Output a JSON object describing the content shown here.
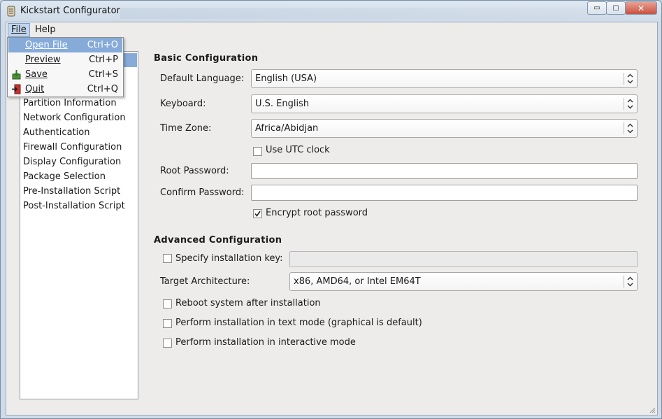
{
  "window": {
    "title": "Kickstart Configurator",
    "minimize_glyph": "▭",
    "maximize_glyph": "▢",
    "close_glyph": "✕"
  },
  "menubar": {
    "file": "File",
    "help": "Help"
  },
  "file_menu": {
    "items": [
      {
        "label": "Open File",
        "accel": "Ctrl+O",
        "icon": ""
      },
      {
        "label": "Preview",
        "accel": "Ctrl+P",
        "icon": ""
      },
      {
        "label": "Save",
        "accel": "Ctrl+S",
        "icon": "save-icon"
      },
      {
        "label": "Quit",
        "accel": "Ctrl+Q",
        "icon": "quit-icon"
      }
    ]
  },
  "sidebar": {
    "items": [
      "Partition Information",
      "Network Configuration",
      "Authentication",
      "Firewall Configuration",
      "Display Configuration",
      "Package Selection",
      "Pre-Installation Script",
      "Post-Installation Script"
    ]
  },
  "basic": {
    "title": "Basic Configuration",
    "language_label": "Default Language:",
    "language_value": "English (USA)",
    "keyboard_label": "Keyboard:",
    "keyboard_value": "U.S. English",
    "timezone_label": "Time Zone:",
    "timezone_value": "Africa/Abidjan",
    "utc_label": "Use UTC clock",
    "utc_checked": false,
    "root_password_label": "Root Password:",
    "confirm_password_label": "Confirm Password:",
    "encrypt_label": "Encrypt root password",
    "encrypt_checked": true
  },
  "advanced": {
    "title": "Advanced Configuration",
    "install_key_label": "Specify installation key:",
    "install_key_checked": false,
    "target_arch_label": "Target Architecture:",
    "target_arch_value": "x86, AMD64, or Intel EM64T",
    "reboot_label": "Reboot system after installation",
    "reboot_checked": false,
    "textmode_label": "Perform installation in text mode (graphical is default)",
    "textmode_checked": false,
    "interactive_label": "Perform installation in interactive mode",
    "interactive_checked": false
  },
  "colors": {
    "selection": "#86abd9",
    "background": "#edeceb"
  }
}
